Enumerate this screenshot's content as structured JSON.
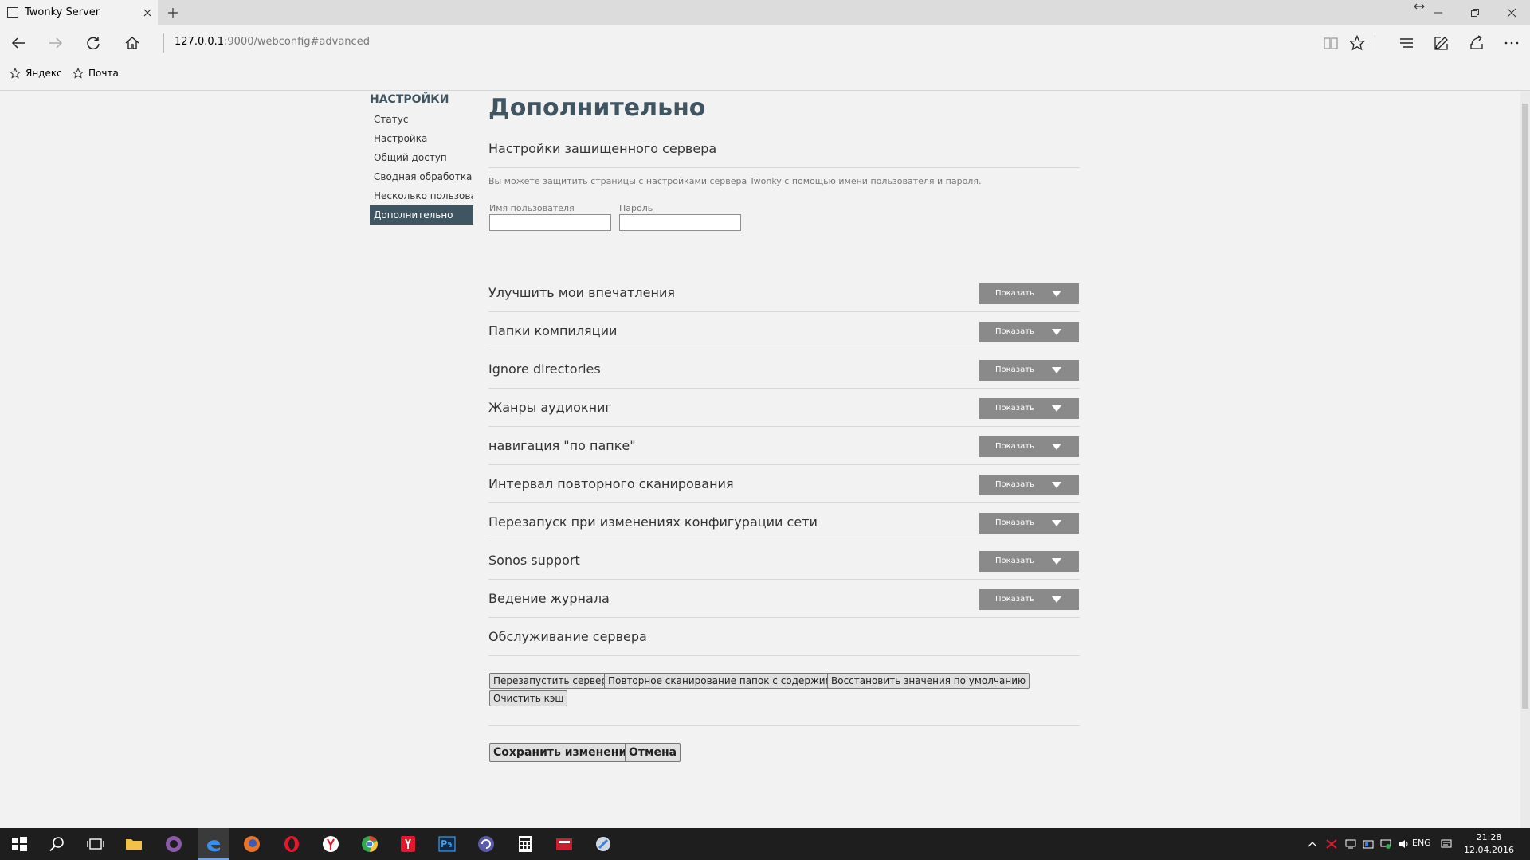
{
  "browser": {
    "tab_title": "Twonky Server",
    "url_host": "127.0.0.1",
    "url_path": ":9000/webconfig#advanced",
    "favorites": [
      {
        "label": "Яндекс"
      },
      {
        "label": "Почта"
      }
    ]
  },
  "sidebar": {
    "title": "НАСТРОЙКИ",
    "items": [
      {
        "label": "Статус",
        "active": false
      },
      {
        "label": "Настройка",
        "active": false
      },
      {
        "label": "Общий доступ",
        "active": false
      },
      {
        "label": "Сводная обработка",
        "active": false
      },
      {
        "label": "Несколько пользовате",
        "active": false
      },
      {
        "label": "Дополнительно",
        "active": true
      }
    ]
  },
  "main": {
    "title": "Дополнительно",
    "secure_section": {
      "title": "Настройки защищенного сервера",
      "description": "Вы можете защитить страницы с настройками сервера Twonky с помощью имени пользователя и пароля.",
      "username_label": "Имя пользователя",
      "username_value": "",
      "password_label": "Пароль",
      "password_value": ""
    },
    "show_label": "Показать",
    "sections": [
      "Улучшить мои впечатления",
      "Папки компиляции",
      "Ignore directories",
      "Жанры аудиокниг",
      "навигация \"по папке\"",
      "Интервал повторного сканирования",
      "Перезапуск при изменениях конфигурации сети",
      "Sonos support",
      "Ведение журнала"
    ],
    "maintenance": {
      "title": "Обслуживание сервера",
      "restart": "Перезапустить сервер",
      "rescan": "Повторное сканирование папок с содержимым",
      "restore": "Восстановить значения по умолчанию",
      "clear_cache": "Очистить кэш"
    },
    "save": "Сохранить изменения",
    "cancel": "Отмена"
  },
  "taskbar": {
    "language": "ENG",
    "time": "21:28",
    "date": "12.04.2016"
  }
}
